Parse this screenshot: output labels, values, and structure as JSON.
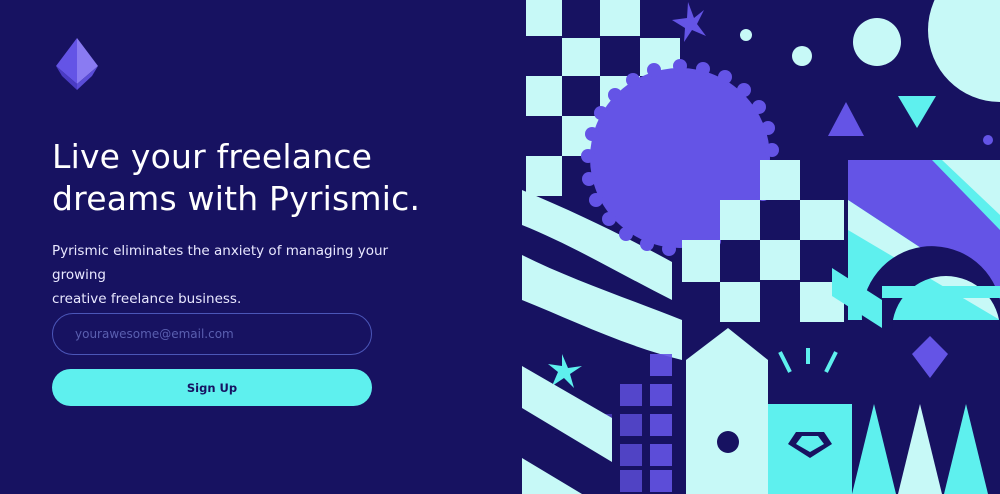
{
  "brand": {
    "logo_icon": "pyramid-logo-icon"
  },
  "hero": {
    "headline_line1": "Live your freelance",
    "headline_line2": "dreams with Pyrismic.",
    "subtext_line1": "Pyrismic eliminates the anxiety of managing your growing",
    "subtext_line2": "creative freelance business."
  },
  "form": {
    "email_placeholder": "yourawesome@email.com",
    "email_value": "",
    "signup_label": "Sign Up"
  },
  "colors": {
    "background": "#171261",
    "accent_cyan": "#5ef0ee",
    "light_cyan": "#c7f9f7",
    "accent_purple": "#6454e6"
  },
  "illustration": {
    "icons": [
      "sparkle-star-icon",
      "diamond-icon",
      "triangle-icon",
      "circle-icon",
      "seal-badge-icon"
    ]
  }
}
